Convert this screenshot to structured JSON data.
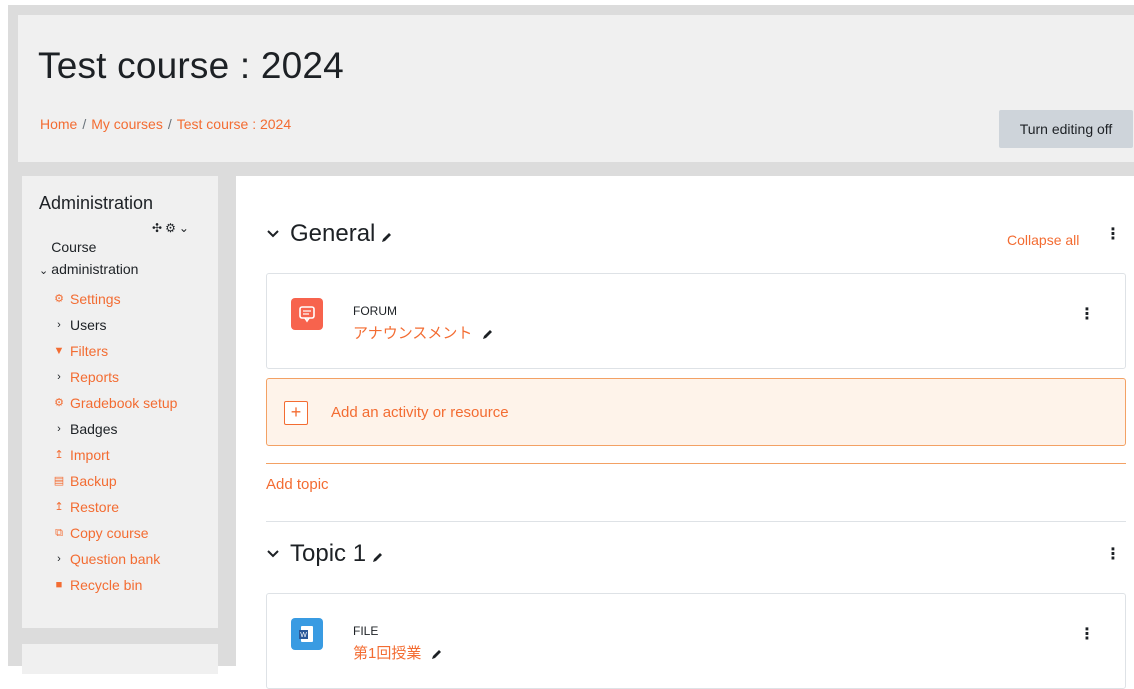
{
  "header": {
    "title": "Test course : 2024",
    "breadcrumb": [
      "Home",
      "My courses",
      "Test course : 2024"
    ],
    "edit_button": "Turn editing off"
  },
  "sidebar": {
    "title": "Administration",
    "course_admin_label": "Course administration",
    "items": [
      {
        "label": "Settings",
        "icon": "gear-icon",
        "link": true
      },
      {
        "label": "Users",
        "icon": "chevron-right-icon",
        "link": false
      },
      {
        "label": "Filters",
        "icon": "filter-icon",
        "link": true
      },
      {
        "label": "Reports",
        "icon": "chevron-right-icon",
        "link": true
      },
      {
        "label": "Gradebook setup",
        "icon": "gear-icon",
        "link": true
      },
      {
        "label": "Badges",
        "icon": "chevron-right-icon",
        "link": false
      },
      {
        "label": "Import",
        "icon": "upload-icon",
        "link": true
      },
      {
        "label": "Backup",
        "icon": "file-icon",
        "link": true
      },
      {
        "label": "Restore",
        "icon": "upload-icon",
        "link": true
      },
      {
        "label": "Copy course",
        "icon": "copy-icon",
        "link": true
      },
      {
        "label": "Question bank",
        "icon": "chevron-right-icon",
        "link": true
      },
      {
        "label": "Recycle bin",
        "icon": "trash-icon",
        "link": true
      }
    ]
  },
  "main": {
    "collapse_all": "Collapse all",
    "sections": [
      {
        "name": "General",
        "activity": {
          "type": "FORUM",
          "name": "アナウンスメント",
          "icon": "forum-icon",
          "color": "#f7634d"
        }
      },
      {
        "name": "Topic 1",
        "activity": {
          "type": "FILE",
          "name": "第1回授業",
          "icon": "word-file-icon",
          "color": "#399be2"
        }
      }
    ],
    "add_activity": "Add an activity or resource",
    "add_topic": "Add topic"
  },
  "colors": {
    "accent": "#f36c32",
    "edit_button": "#ced4da",
    "header_bg": "#f0f0f0"
  }
}
